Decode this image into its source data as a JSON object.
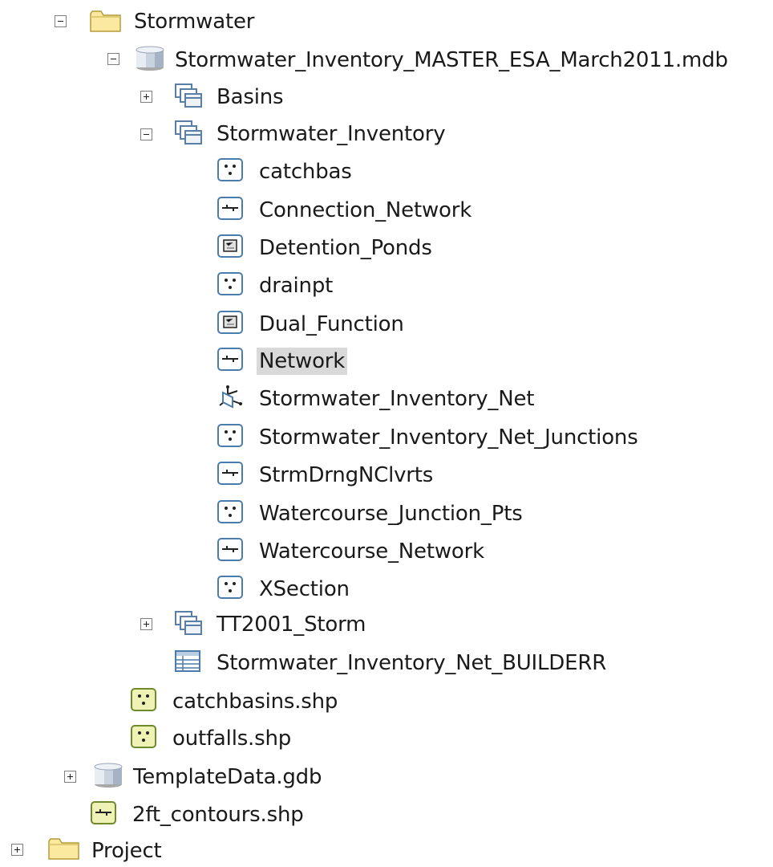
{
  "tree": {
    "stormwater_folder": "Stormwater",
    "mdb": "Stormwater_Inventory_MASTER_ESA_March2011.mdb",
    "basins": "Basins",
    "stormwater_inventory": "Stormwater_Inventory",
    "items": [
      {
        "label": "catchbas",
        "type": "point"
      },
      {
        "label": "Connection_Network",
        "type": "line"
      },
      {
        "label": "Detention_Ponds",
        "type": "polygon"
      },
      {
        "label": "drainpt",
        "type": "point"
      },
      {
        "label": "Dual_Function",
        "type": "polygon"
      },
      {
        "label": "Network",
        "type": "line",
        "selected": true
      },
      {
        "label": "Stormwater_Inventory_Net",
        "type": "geometric-network"
      },
      {
        "label": "Stormwater_Inventory_Net_Junctions",
        "type": "point"
      },
      {
        "label": "StrmDrngNClvrts",
        "type": "line"
      },
      {
        "label": "Watercourse_Junction_Pts",
        "type": "point"
      },
      {
        "label": "Watercourse_Network",
        "type": "line"
      },
      {
        "label": "XSection",
        "type": "point"
      }
    ],
    "tt2001": "TT2001_Storm",
    "builderr": "Stormwater_Inventory_Net_BUILDERR",
    "catchbasins_shp": "catchbasins.shp",
    "outfalls_shp": "outfalls.shp",
    "templatedata": "TemplateData.gdb",
    "contours_shp": "2ft_contours.shp",
    "project_folder": "Project"
  }
}
